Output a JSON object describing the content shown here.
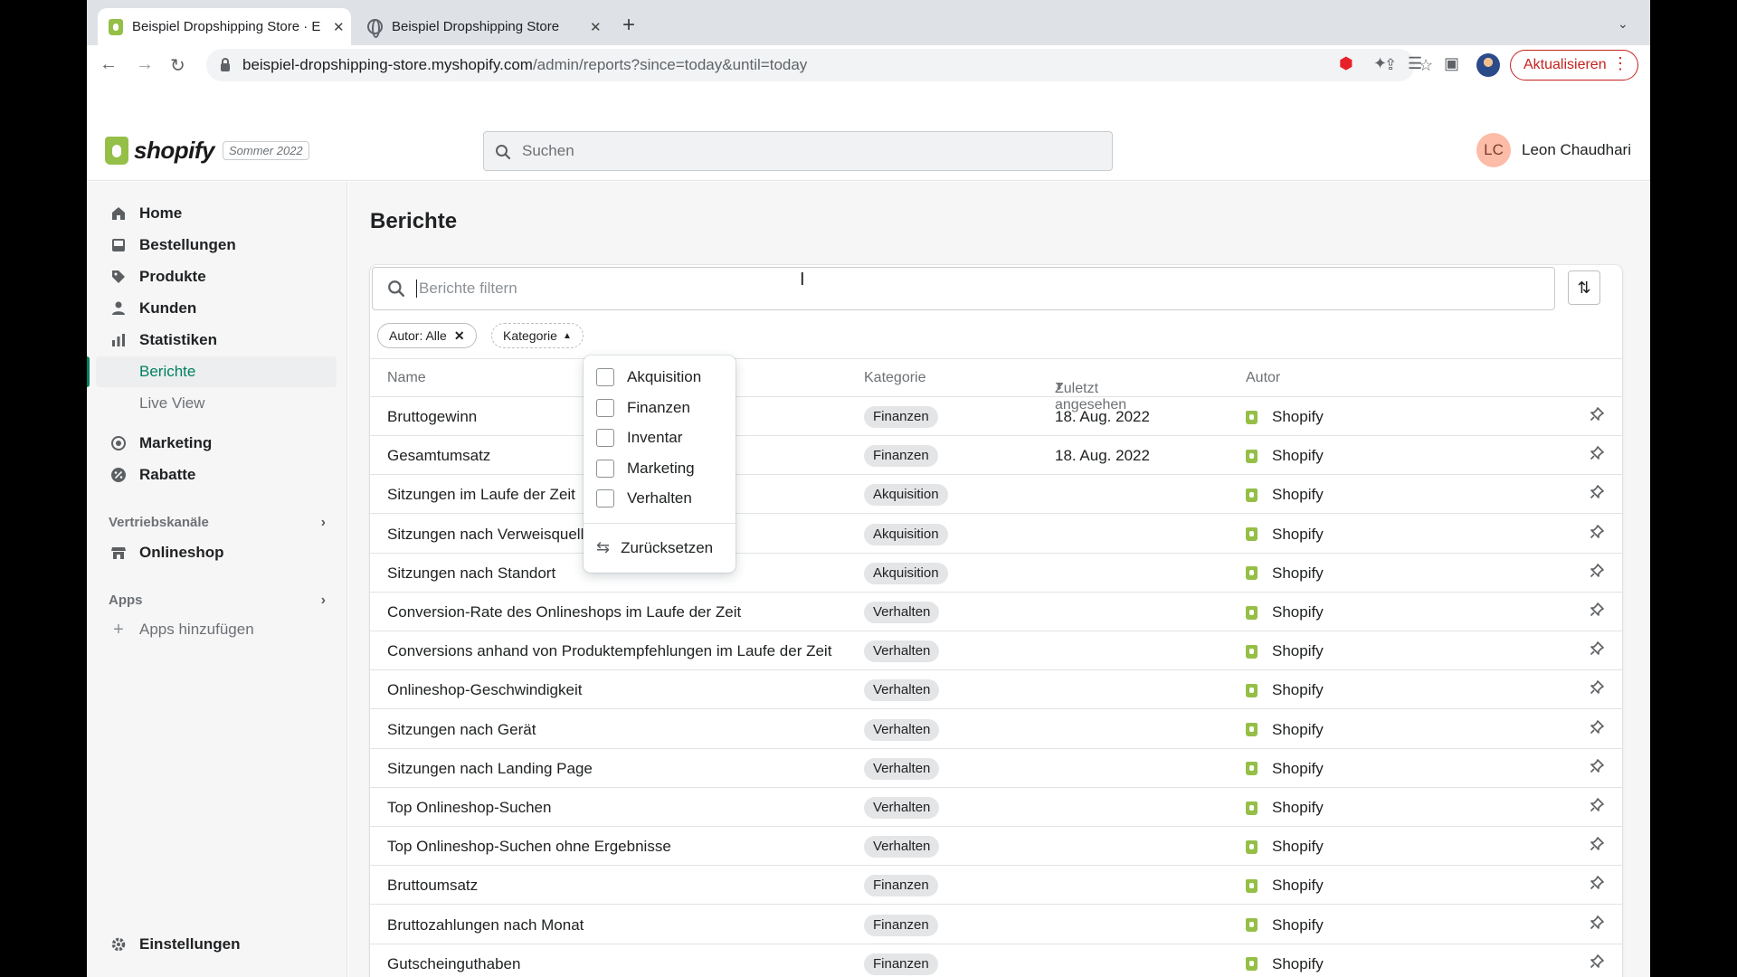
{
  "browser": {
    "tabs": [
      {
        "title": "Beispiel Dropshipping Store · E",
        "icon": "shopify-favicon"
      },
      {
        "title": "Beispiel Dropshipping Store",
        "icon": "globe-icon"
      }
    ],
    "url_host": "beispiel-dropshipping-store.myshopify.com",
    "url_path": "/admin/reports?since=today&until=today",
    "update_label": "Aktualisieren"
  },
  "topbar": {
    "logo_text": "shopify",
    "edition": "Sommer 2022",
    "search_placeholder": "Suchen",
    "avatar_initials": "LC",
    "user_name": "Leon Chaudhari"
  },
  "sidebar": {
    "items": [
      {
        "label": "Home",
        "icon": "home-icon"
      },
      {
        "label": "Bestellungen",
        "icon": "orders-icon"
      },
      {
        "label": "Produkte",
        "icon": "tag-icon"
      },
      {
        "label": "Kunden",
        "icon": "person-icon"
      },
      {
        "label": "Statistiken",
        "icon": "bar-chart-icon"
      }
    ],
    "sub_items": [
      {
        "label": "Berichte",
        "selected": true
      },
      {
        "label": "Live View",
        "selected": false
      }
    ],
    "items2": [
      {
        "label": "Marketing",
        "icon": "target-icon"
      },
      {
        "label": "Rabatte",
        "icon": "discount-icon"
      }
    ],
    "sales_channels_label": "Vertriebskanäle",
    "onlineshop_label": "Onlineshop",
    "apps_label": "Apps",
    "add_apps_label": "Apps hinzufügen",
    "settings_label": "Einstellungen"
  },
  "main": {
    "title": "Berichte",
    "filter_placeholder": "Berichte filtern",
    "chips": {
      "author": "Autor: Alle",
      "category": "Kategorie"
    },
    "columns": {
      "name": "Name",
      "category": "Kategorie",
      "last_viewed": "Zuletzt angesehen",
      "author": "Autor"
    },
    "rows": [
      {
        "name": "Bruttogewinn",
        "category": "Finanzen",
        "last_viewed": "18. Aug. 2022",
        "author": "Shopify"
      },
      {
        "name": "Gesamtumsatz",
        "category": "Finanzen",
        "last_viewed": "18. Aug. 2022",
        "author": "Shopify"
      },
      {
        "name": "Sitzungen im Laufe der Zeit",
        "category": "Akquisition",
        "last_viewed": "",
        "author": "Shopify"
      },
      {
        "name": "Sitzungen nach Verweisquelle",
        "category": "Akquisition",
        "last_viewed": "",
        "author": "Shopify"
      },
      {
        "name": "Sitzungen nach Standort",
        "category": "Akquisition",
        "last_viewed": "",
        "author": "Shopify"
      },
      {
        "name": "Conversion-Rate des Onlineshops im Laufe der Zeit",
        "category": "Verhalten",
        "last_viewed": "",
        "author": "Shopify"
      },
      {
        "name": "Conversions anhand von Produktempfehlungen im Laufe der Zeit",
        "category": "Verhalten",
        "last_viewed": "",
        "author": "Shopify"
      },
      {
        "name": "Onlineshop-Geschwindigkeit",
        "category": "Verhalten",
        "last_viewed": "",
        "author": "Shopify"
      },
      {
        "name": "Sitzungen nach Gerät",
        "category": "Verhalten",
        "last_viewed": "",
        "author": "Shopify"
      },
      {
        "name": "Sitzungen nach Landing Page",
        "category": "Verhalten",
        "last_viewed": "",
        "author": "Shopify"
      },
      {
        "name": "Top Onlineshop-Suchen",
        "category": "Verhalten",
        "last_viewed": "",
        "author": "Shopify"
      },
      {
        "name": "Top Onlineshop-Suchen ohne Ergebnisse",
        "category": "Verhalten",
        "last_viewed": "",
        "author": "Shopify"
      },
      {
        "name": "Bruttoumsatz",
        "category": "Finanzen",
        "last_viewed": "",
        "author": "Shopify"
      },
      {
        "name": "Bruttozahlungen nach Monat",
        "category": "Finanzen",
        "last_viewed": "",
        "author": "Shopify"
      },
      {
        "name": "Gutscheinguthaben",
        "category": "Finanzen",
        "last_viewed": "",
        "author": "Shopify"
      }
    ]
  },
  "dropdown": {
    "options": [
      "Akquisition",
      "Finanzen",
      "Inventar",
      "Marketing",
      "Verhalten"
    ],
    "reset_label": "Zurücksetzen"
  }
}
